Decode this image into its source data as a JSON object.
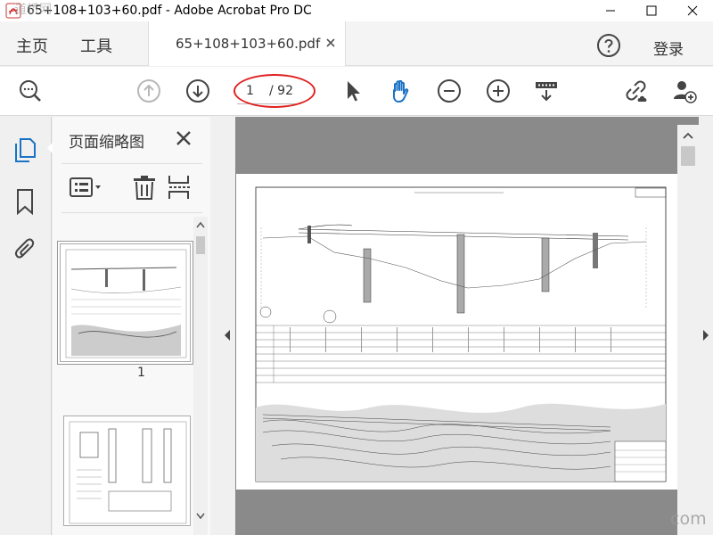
{
  "window": {
    "title": "65+108+103+60.pdf - Adobe Acrobat Pro DC",
    "watermark": "道桥网",
    "watermark_url": "com"
  },
  "menu": {
    "home": "主页",
    "tools": "工具",
    "tab_label": "65+108+103+60.pdf",
    "login": "登录"
  },
  "toolbar": {
    "current_page": "1",
    "total_pages": "/ 92"
  },
  "thumbnails": {
    "title": "页面缩略图",
    "page_1_label": "1"
  },
  "colors": {
    "accent": "#1a73c4",
    "highlight": "#e02020"
  }
}
